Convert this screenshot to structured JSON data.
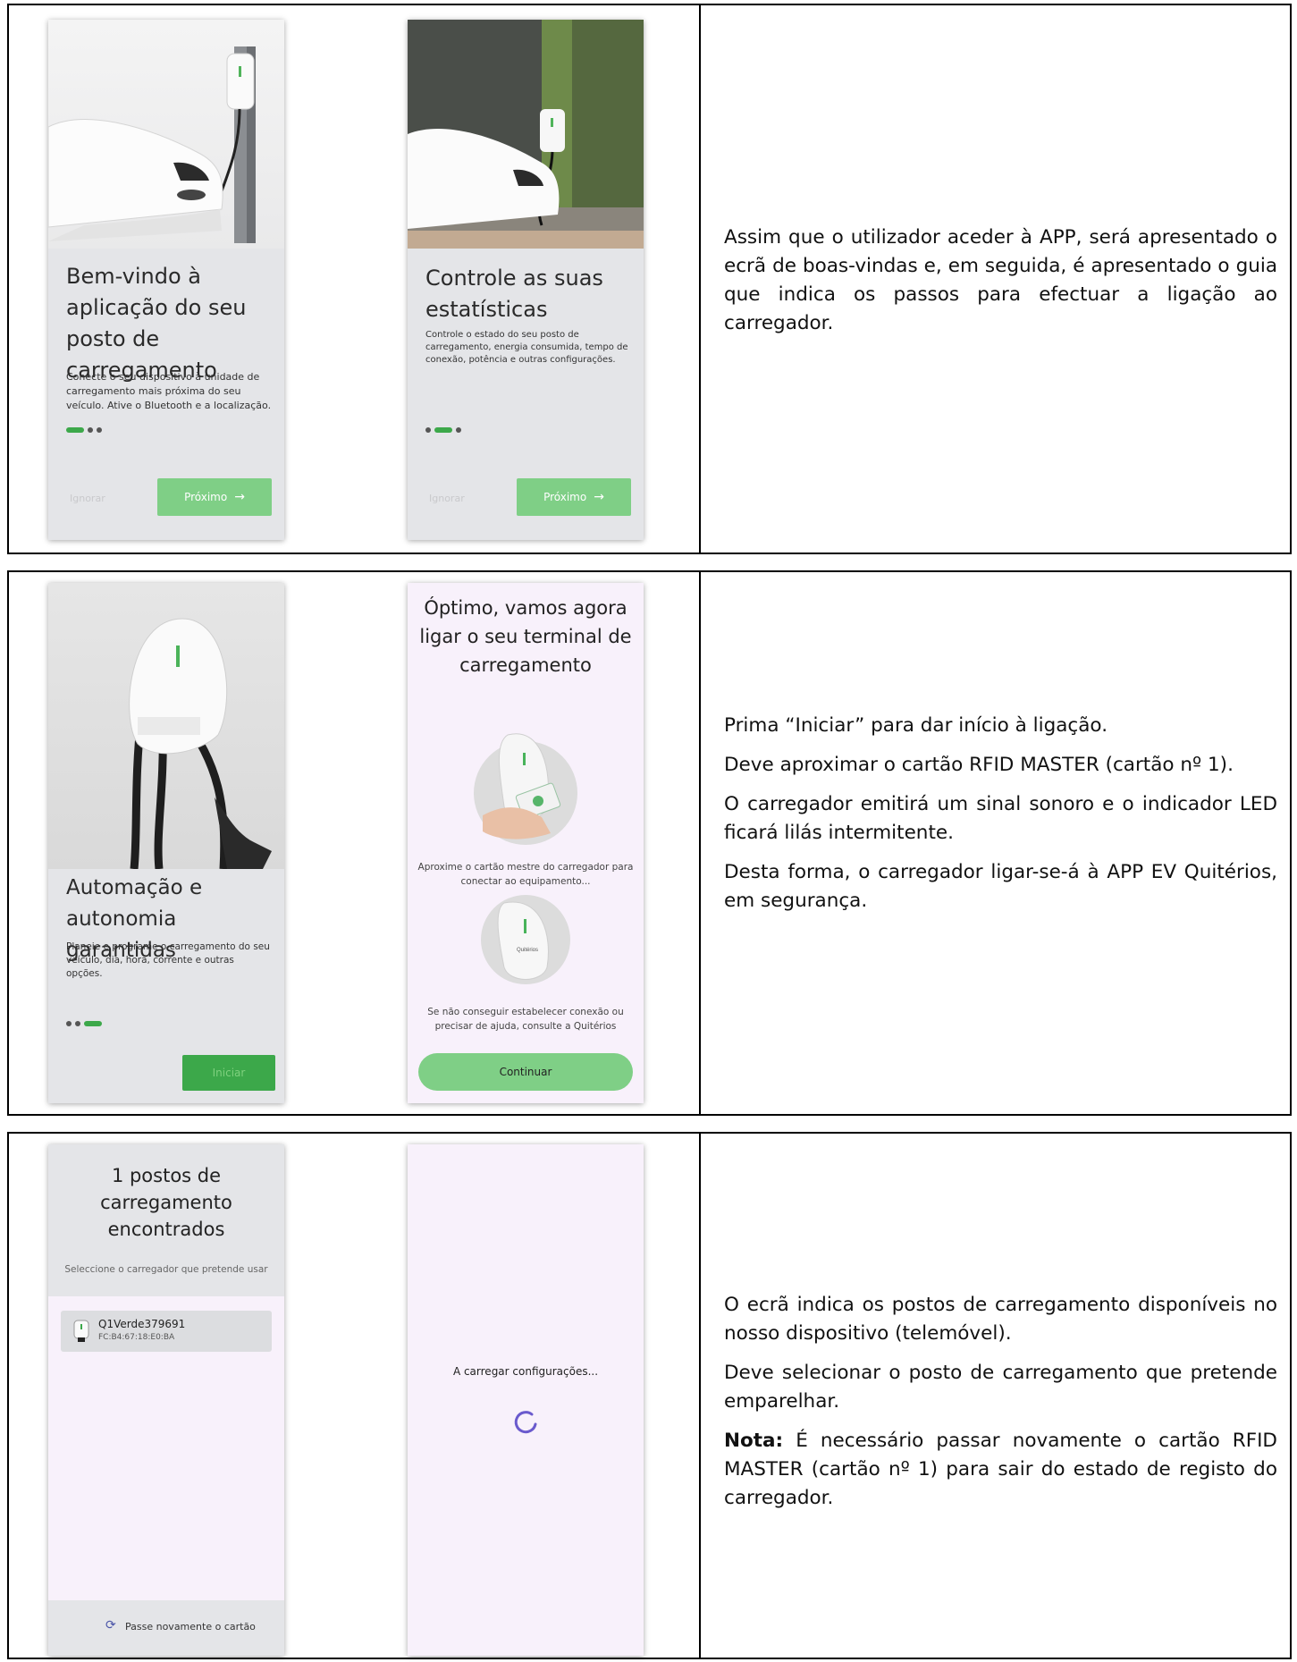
{
  "rows": [
    {
      "description": [
        "Assim que o utilizador aceder à APP, será apresentado o ecrã de boas-vindas e, em seguida, é apresentado o guia que indica os passos para efectuar a ligação ao carregador."
      ],
      "screens": [
        {
          "title": "Bem-vindo à aplicação do seu posto de carregamento",
          "body": "Conecte o seu dispositivo à unidade de carregamento mais próxima do seu veículo. Ative o Bluetooth e a localização.",
          "active_dot": 1,
          "skip_label": "Ignorar",
          "next_label": "Próximo",
          "next_icon": "→"
        },
        {
          "title": "Controle as suas estatísticas",
          "body": "Controle o estado do seu posto de carregamento, energia consumida, tempo de conexão, potência e outras configurações.",
          "active_dot": 2,
          "skip_label": "Ignorar",
          "next_label": "Próximo",
          "next_icon": "→"
        }
      ]
    },
    {
      "description": [
        "Prima “Iniciar” para dar início à ligação.",
        "Deve aproximar o cartão RFID MASTER (cartão nº 1).",
        "O carregador emitirá um sinal sonoro e o indicador LED ficará lilás intermitente.",
        "Desta forma, o carregador ligar-se-á à APP EV Quitérios, em segurança."
      ],
      "screens": [
        {
          "title": "Automação e autonomia garantidas",
          "body": "Planeie e programe o carregamento do seu veículo, dia, hora, corrente e outras opções.",
          "active_dot": 3,
          "start_label": "Iniciar"
        },
        {
          "heading": "Óptimo, vamos agora ligar o seu terminal de carregamento",
          "brand": "Quitérios",
          "tap_text": "Aproxime o cartão mestre do carregador para conectar ao equipamento...",
          "help_text": "Se não conseguir estabelecer conexão ou precisar de ajuda, consulte a Quitérios",
          "continue_label": "Continuar"
        }
      ]
    },
    {
      "description_text": "O ecrã indica os postos de carregamento disponíveis no nosso dispositivo (telemóvel).",
      "description_text_2": "Deve selecionar o posto de carregamento que pretende emparelhar.",
      "note_label": "Nota:",
      "note_text": " É necessário passar novamente o cartão RFID MASTER (cartão nº 1) para sair do estado de registo do carregador.",
      "screens": [
        {
          "heading": "1 postos de carregamento encontrados",
          "subtitle": "Seleccione o carregador que pretende usar",
          "charger_name": "Q1Verde379691",
          "charger_mac": "FC:B4:67:18:E0:BA",
          "rescan_label": "Passe novamente o cartão",
          "rescan_icon": "refresh-icon"
        },
        {
          "loading_text": "A carregar configurações...",
          "spinner_icon": "spinner-icon"
        }
      ]
    }
  ],
  "colors": {
    "accent_green": "#7fcf86",
    "dark_green": "#3ca84a",
    "phone_grey": "#e4e5e8",
    "lavender": "#f8f1fb",
    "spinner_purple": "#6a5acd"
  }
}
